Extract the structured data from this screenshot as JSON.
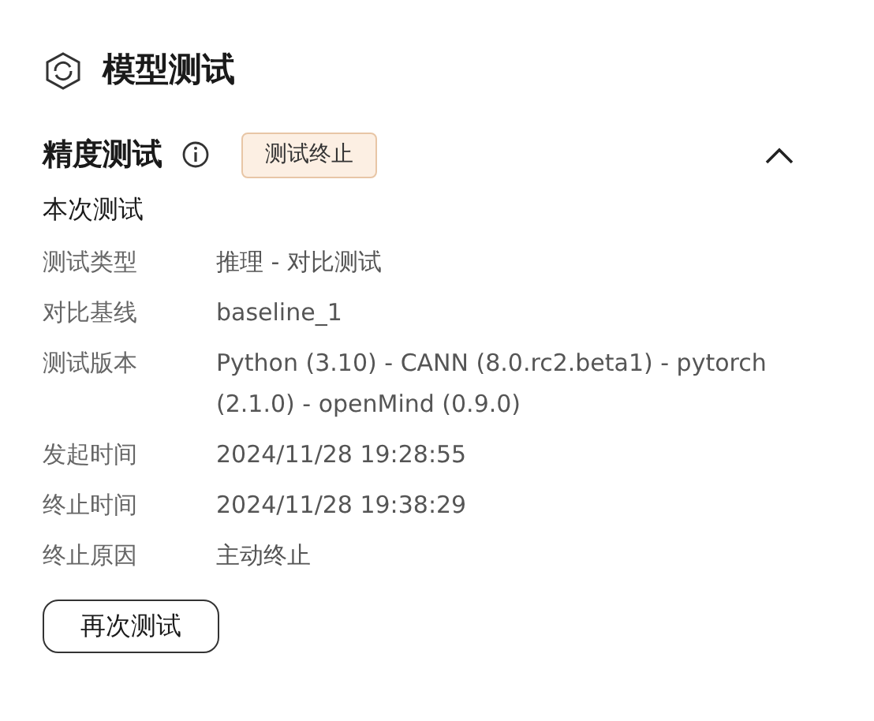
{
  "page_title": "模型测试",
  "section": {
    "title": "精度测试",
    "status_badge": "测试终止",
    "expanded": true
  },
  "subsection_title": "本次测试",
  "fields": [
    {
      "label": "测试类型",
      "value": "推理 - 对比测试"
    },
    {
      "label": "对比基线",
      "value": "baseline_1"
    },
    {
      "label": "测试版本",
      "value": "Python (3.10) - CANN (8.0.rc2.beta1) - pytorch (2.1.0) - openMind (0.9.0)"
    },
    {
      "label": "发起时间",
      "value": "2024/11/28 19:28:55"
    },
    {
      "label": "终止时间",
      "value": "2024/11/28 19:38:29"
    },
    {
      "label": "终止原因",
      "value": "主动终止"
    }
  ],
  "retest_button": "再次测试"
}
